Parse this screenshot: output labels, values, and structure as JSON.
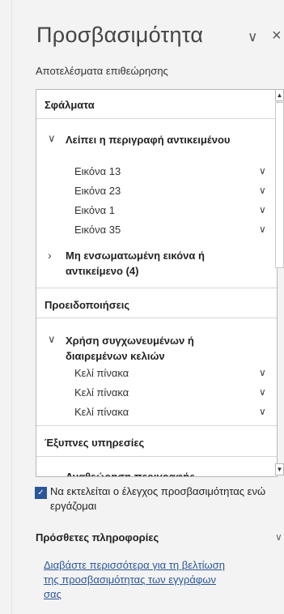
{
  "pane": {
    "title": "Προσβασιμότητα",
    "title_chevron_icon": "chevron-down",
    "close_icon": "close",
    "subtitle": "Αποτελέσματα επιθεώρησης"
  },
  "results": {
    "errors": {
      "heading": "Σφάλματα",
      "groups": [
        {
          "label": "Λείπει η περιγραφή αντικειμένου",
          "expanded": true,
          "items": [
            "Εικόνα 13",
            "Εικόνα 23",
            "Εικόνα 1",
            "Εικόνα 35"
          ]
        },
        {
          "label": "Μη ενσωματωμένη εικόνα ή αντικείμενο (4)",
          "expanded": false
        }
      ]
    },
    "warnings": {
      "heading": "Προειδοποιήσεις",
      "groups": [
        {
          "label": "Χρήση συγχωνευμένων ή διαιρεμένων κελιών",
          "expanded": true,
          "items": [
            "Κελί πίνακα",
            "Κελί πίνακα",
            "Κελί πίνακα"
          ]
        }
      ]
    },
    "smart": {
      "heading": "Έξυπνες υπηρεσίες",
      "next_group": "Αναθεώρηση περιγραφής"
    }
  },
  "checkbox": {
    "label": "Να εκτελείται ο έλεγχος προσβασιμότητας ενώ εργάζομαι",
    "checked": true
  },
  "info": {
    "heading": "Πρόσθετες πληροφορίες",
    "link_lines": [
      "Διαβάστε περισσότερα για τη βελτίωση",
      "της προσβασιμότητας των εγγράφων",
      "σας"
    ]
  },
  "colors": {
    "accent": "#2b579a",
    "pane_bg": "#f3f3f3"
  }
}
